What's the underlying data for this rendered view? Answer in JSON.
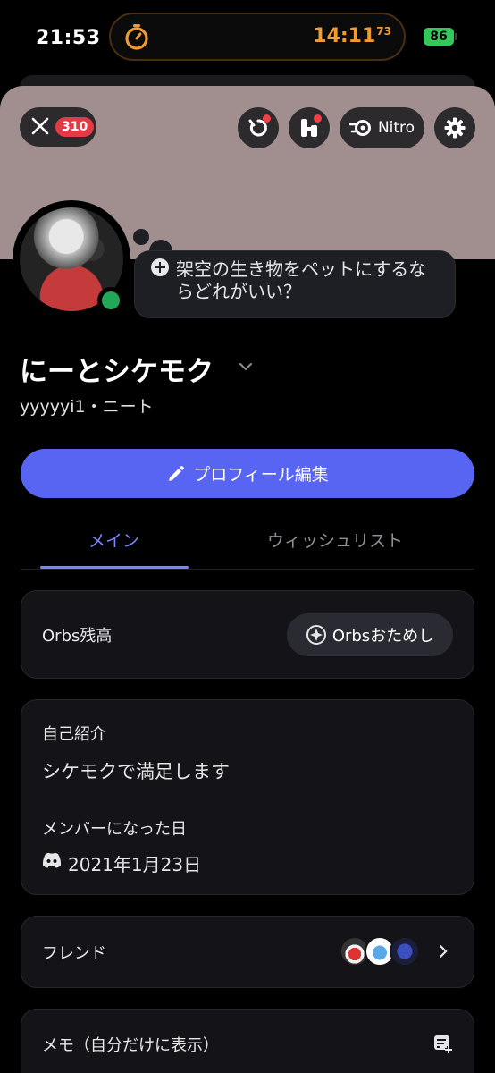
{
  "status_bar": {
    "time": "21:53",
    "timer_time": "14:11",
    "timer_hundredths": "73",
    "battery": "86",
    "timer_color": "#f29a2e",
    "battery_color": "#34c759"
  },
  "header": {
    "close_badge_count": "310",
    "nitro_label": "Nitro",
    "banner_color": "#a18f8f",
    "icons": [
      "close-icon",
      "quest-icon",
      "shop-icon",
      "nitro-icon",
      "gear-icon"
    ]
  },
  "profile": {
    "status_message": "架空の生き物をペットにするならどれがいい？",
    "display_name": "にーとシケモク",
    "username_line": "yyyyyi1・ニート",
    "online_color": "#23a55a"
  },
  "actions": {
    "edit_profile_label": "プロフィール編集",
    "accent_color": "#5865f2"
  },
  "tabs": [
    {
      "label": "メイン",
      "active": true
    },
    {
      "label": "ウィッシュリスト",
      "active": false
    }
  ],
  "orbs": {
    "label": "Orbs残高",
    "button_label": "Orbsおためし"
  },
  "about": {
    "bio_heading": "自己紹介",
    "bio_text": "シケモクで満足します",
    "member_since_heading": "メンバーになった日",
    "member_since_date": "2021年1月23日"
  },
  "friends": {
    "label": "フレンド"
  },
  "memo": {
    "label": "メモ（自分だけに表示）"
  }
}
